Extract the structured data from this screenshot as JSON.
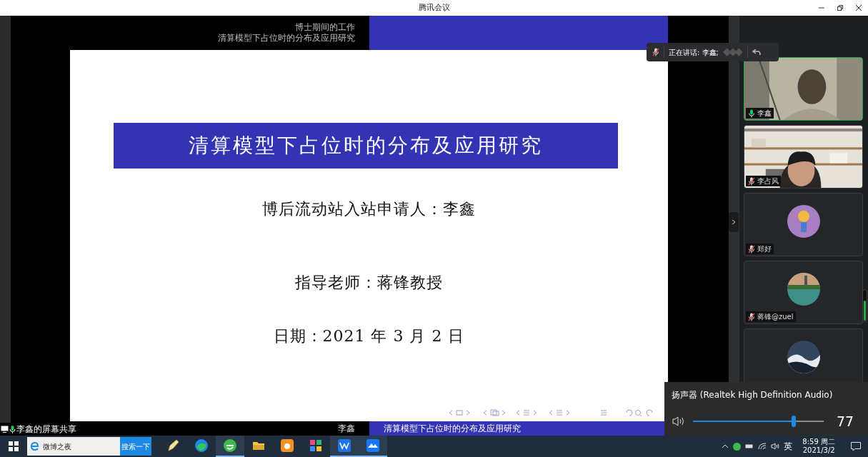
{
  "window": {
    "title": "腾讯会议"
  },
  "slide": {
    "header_section": "博士期间的工作",
    "header_title": "清算模型下占位时的分布及应用研究",
    "title": "清算模型下占位时的分布及应用研究",
    "lines": [
      "博后流动站入站申请人：李鑫",
      "指导老师：蒋锋教授",
      "日期：2021 年 3 月 2 日"
    ],
    "footer_author": "李鑫",
    "footer_title": "清算模型下占位时的分布及应用研究"
  },
  "screen_share_label": "李鑫的屏幕共享",
  "speaking_bar": {
    "label": "正在讲话: 李鑫;",
    "muted": true
  },
  "participants": [
    {
      "name": "李鑫",
      "muted": false,
      "selected": true,
      "kind": "video"
    },
    {
      "name": "李占风",
      "muted": true,
      "selected": false,
      "kind": "video"
    },
    {
      "name": "郑好",
      "muted": true,
      "selected": false,
      "kind": "avatar",
      "color": "#a77fc2"
    },
    {
      "name": "蒋锋@zuel",
      "muted": true,
      "selected": false,
      "kind": "avatar",
      "color": "#3f8f86"
    },
    {
      "kind": "avatar",
      "selected": false,
      "color": "#33465e"
    }
  ],
  "volume": {
    "device": "扬声器 (Realtek High Definition Audio)",
    "level": 0.77,
    "reading": "77"
  },
  "taskbar": {
    "search_value": "微博之夜",
    "search_button": "搜索一下",
    "apps": [
      {
        "kind": "pen",
        "running": false
      },
      {
        "kind": "edge",
        "running": false
      },
      {
        "kind": "ie",
        "running": true
      },
      {
        "kind": "folder",
        "running": false
      },
      {
        "kind": "uc",
        "running": false
      },
      {
        "kind": "tiles",
        "running": false
      },
      {
        "kind": "wps",
        "running": true
      },
      {
        "kind": "meeting",
        "running": true
      }
    ],
    "ime": "英",
    "time": "8:59 周二",
    "date": "2021/3/2"
  }
}
